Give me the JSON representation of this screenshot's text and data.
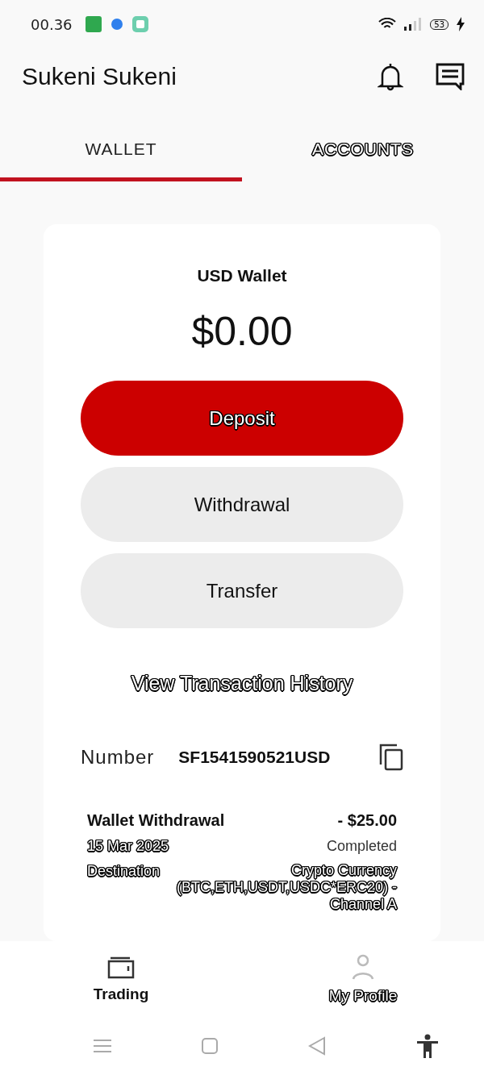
{
  "status_bar": {
    "time": "00.36",
    "battery": "53"
  },
  "header": {
    "title": "Sukeni Sukeni"
  },
  "tabs": [
    {
      "label": "WALLET",
      "selected": true
    },
    {
      "label": "ACCOUNTS",
      "selected": false
    }
  ],
  "wallet": {
    "title": "USD Wallet",
    "balance": "$0.00",
    "actions": [
      {
        "label": "Deposit",
        "primary": true
      },
      {
        "label": "Withdrawal",
        "primary": false
      },
      {
        "label": "Transfer",
        "primary": false
      }
    ],
    "history_link": "View Transaction History",
    "number_label": "Number",
    "number": "SF1541590521USD"
  },
  "transactions": [
    {
      "title": "Wallet Withdrawal",
      "amount": "- $25.00",
      "date": "15 Mar 2025",
      "status": "Completed",
      "detail_label": "Destination",
      "detail_value": "Crypto Currency (BTC,ETH,USDT,USDC*ERC20) - Channel A"
    }
  ],
  "bottom_nav": [
    {
      "label": "Trading",
      "selected": true,
      "kind": "wallet"
    },
    {
      "label": "My Profile",
      "selected": false,
      "kind": "person"
    }
  ]
}
